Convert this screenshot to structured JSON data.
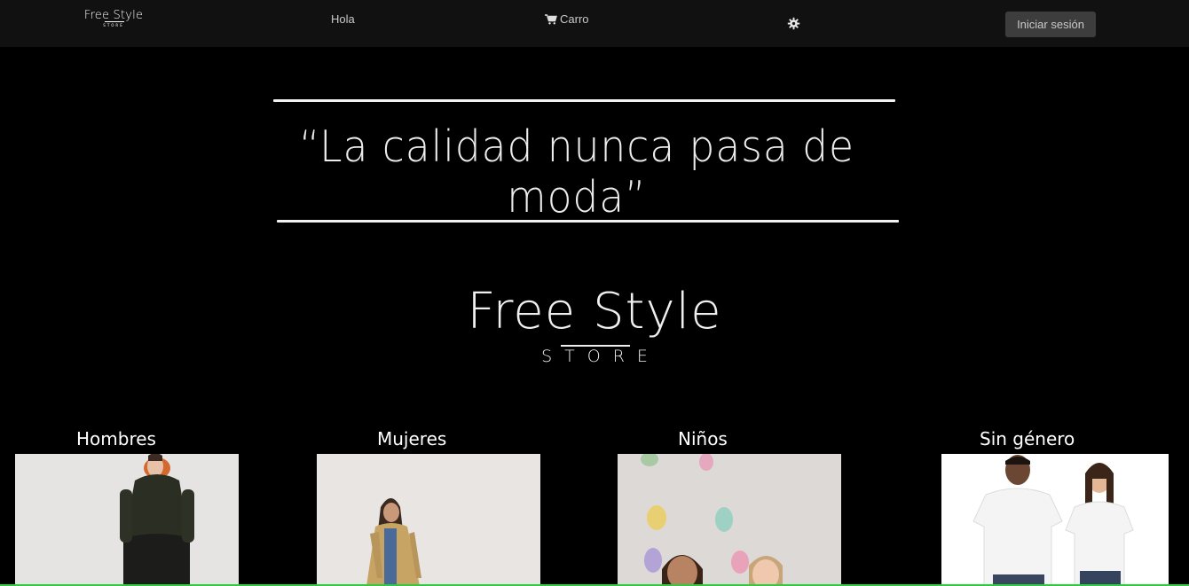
{
  "nav": {
    "logo_main": "Free Style",
    "logo_sub": "STORE",
    "link_hola": "Hola",
    "link_carro": "Carro",
    "login_label": "Iniciar sesión",
    "icons": [
      "cart-icon",
      "gear-icon"
    ]
  },
  "hero": {
    "quote": "“La calidad nunca pasa de moda”",
    "brand_main": "Free Style",
    "brand_sub": "STORE"
  },
  "categories": [
    {
      "label": "Hombres"
    },
    {
      "label": "Mujeres"
    },
    {
      "label": "Niños"
    },
    {
      "label": "Sin género"
    }
  ],
  "colors": {
    "navbar": "#111111",
    "background": "#000000",
    "button": "#3d3d3d",
    "accent_line": "#2ecc40"
  }
}
